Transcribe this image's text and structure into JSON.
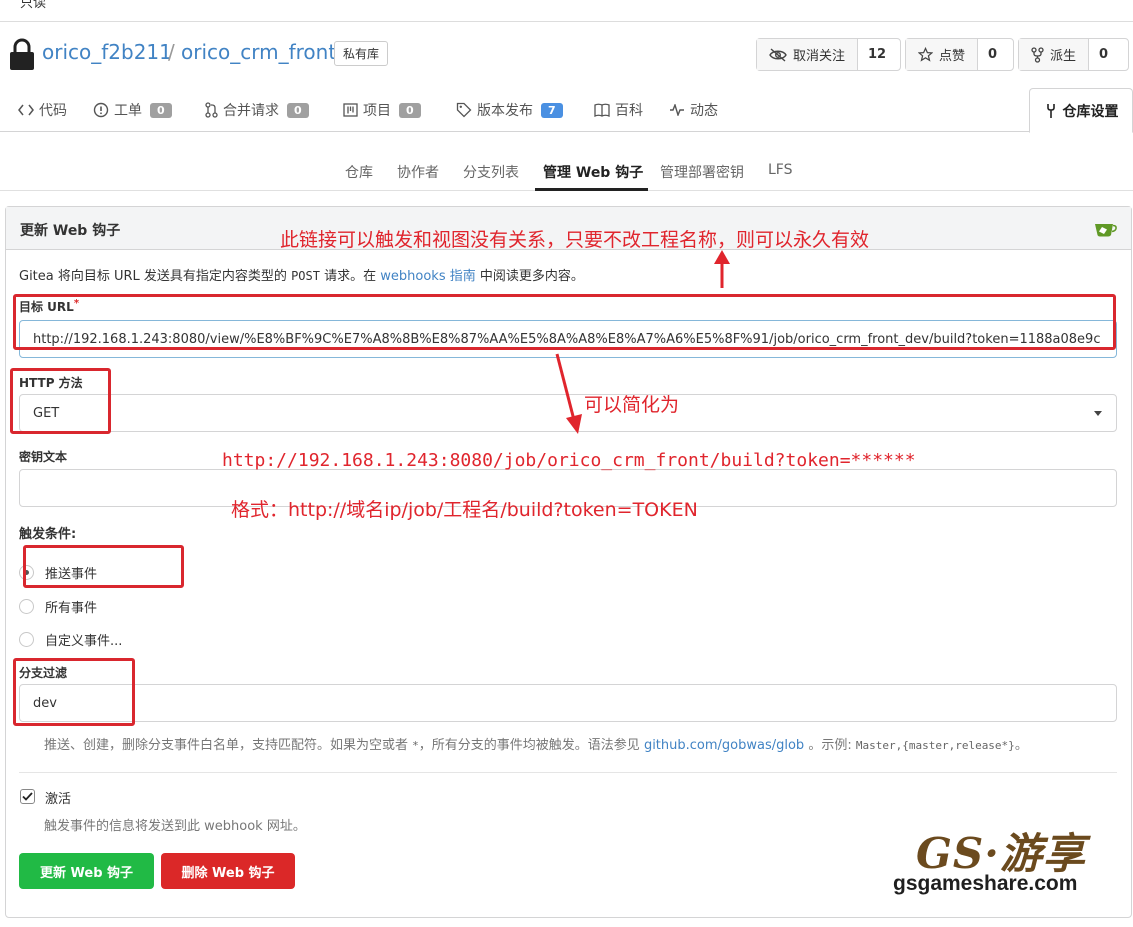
{
  "top_strip": {
    "text": "只读"
  },
  "repo": {
    "owner": "orico_f2b211",
    "separator": "/",
    "name": "orico_crm_front",
    "private_label": "私有库"
  },
  "actions": {
    "watch": {
      "label": "取消关注",
      "count": "12"
    },
    "star": {
      "label": "点赞",
      "count": "0"
    },
    "fork": {
      "label": "派生",
      "count": "0"
    }
  },
  "tabs": [
    {
      "label": "代码",
      "icon": "code-icon"
    },
    {
      "label": "工单",
      "count": "0",
      "icon": "issue-icon"
    },
    {
      "label": "合并请求",
      "count": "0",
      "icon": "pull-request-icon"
    },
    {
      "label": "项目",
      "count": "0",
      "icon": "project-icon"
    },
    {
      "label": "版本发布",
      "count": "7",
      "icon": "tag-icon"
    },
    {
      "label": "百科",
      "icon": "book-icon"
    },
    {
      "label": "动态",
      "icon": "pulse-icon"
    }
  ],
  "settings_tab": {
    "label": "仓库设置",
    "icon": "tools-icon"
  },
  "subtabs": [
    "仓库",
    "协作者",
    "分支列表",
    "管理 Web 钩子",
    "管理部署密钥",
    "LFS"
  ],
  "panel": {
    "title": "更新 Web 钩子",
    "info_prefix": "Gitea 将向目标 URL 发送具有指定内容类型的",
    "info_method": "POST",
    "info_mid": "请求。在",
    "info_link": "webhooks 指南",
    "info_suffix": "中阅读更多内容。"
  },
  "form": {
    "url_label": "目标 URL",
    "url_required": "*",
    "url_value": "http://192.168.1.243:8080/view/%E8%BF%9C%E7%A8%8B%E8%87%AA%E5%8A%A8%E8%A7%A6%E5%8F%91/job/orico_crm_front_dev/build?token=1188a08e9c",
    "method_label": "HTTP 方法",
    "method_value": "GET",
    "secret_label": "密钥文本",
    "secret_value": "",
    "trigger_label": "触发条件:",
    "trigger_options": [
      "推送事件",
      "所有事件",
      "自定义事件..."
    ],
    "trigger_selected": "推送事件",
    "branch_label": "分支过滤",
    "branch_value": "dev",
    "branch_help_prefix": "推送、创建，删除分支事件白名单，支持匹配符。如果为空或者",
    "branch_help_star": "*",
    "branch_help_mid": "，所有分支的事件均被触发。语法参见",
    "branch_help_link": "github.com/gobwas/glob",
    "branch_help_example_prefix": "。示例:",
    "branch_help_example": "Master,{master,release*}",
    "branch_help_end": "。",
    "active_label": "激活",
    "active_checked": true,
    "active_help": "触发事件的信息将发送到此 webhook 网址。",
    "update_button": "更新 Web 钩子",
    "delete_button": "删除 Web 钩子"
  },
  "annotations": {
    "note1": "此链接可以触发和视图没有关系，只要不改工程名称，则可以永久有效",
    "note2": "可以简化为",
    "note3": "http://192.168.1.243:8080/job/orico_crm_front/build?token=******",
    "note4": "格式：http://域名ip/job/工程名/build?token=TOKEN"
  },
  "watermark": {
    "logo": "GS·游享",
    "url": "gsgameshare.com"
  },
  "colors": {
    "link": "#4183c4",
    "annotation_red": "#e0252d",
    "update_green": "#21ba45",
    "delete_red": "#db2828",
    "badge_blue": "#4a90e2"
  }
}
